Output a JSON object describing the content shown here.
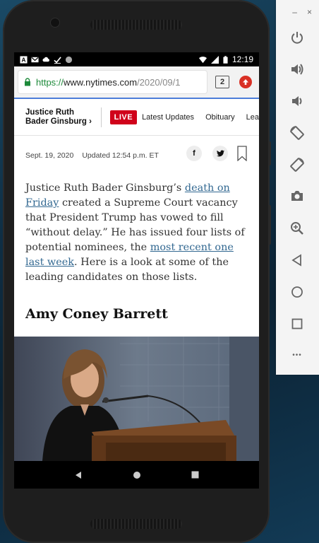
{
  "status_bar": {
    "time": "12:19"
  },
  "browser": {
    "url_scheme": "https://",
    "url_host": "www.nytimes.com",
    "url_path": "/2020/09/1",
    "tab_count": "2"
  },
  "nav": {
    "section_title_line1": "Justice Ruth",
    "section_title_line2": "Bader Ginsburg",
    "chevron": "›",
    "live_label": "LIVE",
    "links": [
      "Latest Updates",
      "Obituary",
      "Lea"
    ]
  },
  "meta": {
    "date": "Sept. 19, 2020",
    "updated": "Updated 12:54 p.m. ET",
    "share_facebook": "f",
    "share_twitter": "t"
  },
  "article": {
    "p1_a": "Justice Ruth Bader Ginsburg’s ",
    "link1": "death on Friday",
    "p1_b": " created a Supreme Court vacancy that President Trump has vowed to fill “without delay.” He has issued four lists of potential nominees, the ",
    "link2": "most recent one last week",
    "p1_c": ". Here is a look at some of the leading candidates on those lists.",
    "headline": "Amy Coney Barrett"
  },
  "emulator": {
    "close_label": "×",
    "minimize_label": "–",
    "more_label": "•••",
    "buttons": [
      "power-icon",
      "volume-up-icon",
      "volume-down-icon",
      "rotate-left-icon",
      "rotate-right-icon",
      "camera-icon",
      "zoom-icon",
      "back-icon",
      "home-icon",
      "overview-icon",
      "more-icon"
    ]
  },
  "colors": {
    "live_red": "#d0021b",
    "link_blue": "#326891",
    "url_green": "#1d8a3a",
    "accent_blue": "#4d7ed9"
  }
}
